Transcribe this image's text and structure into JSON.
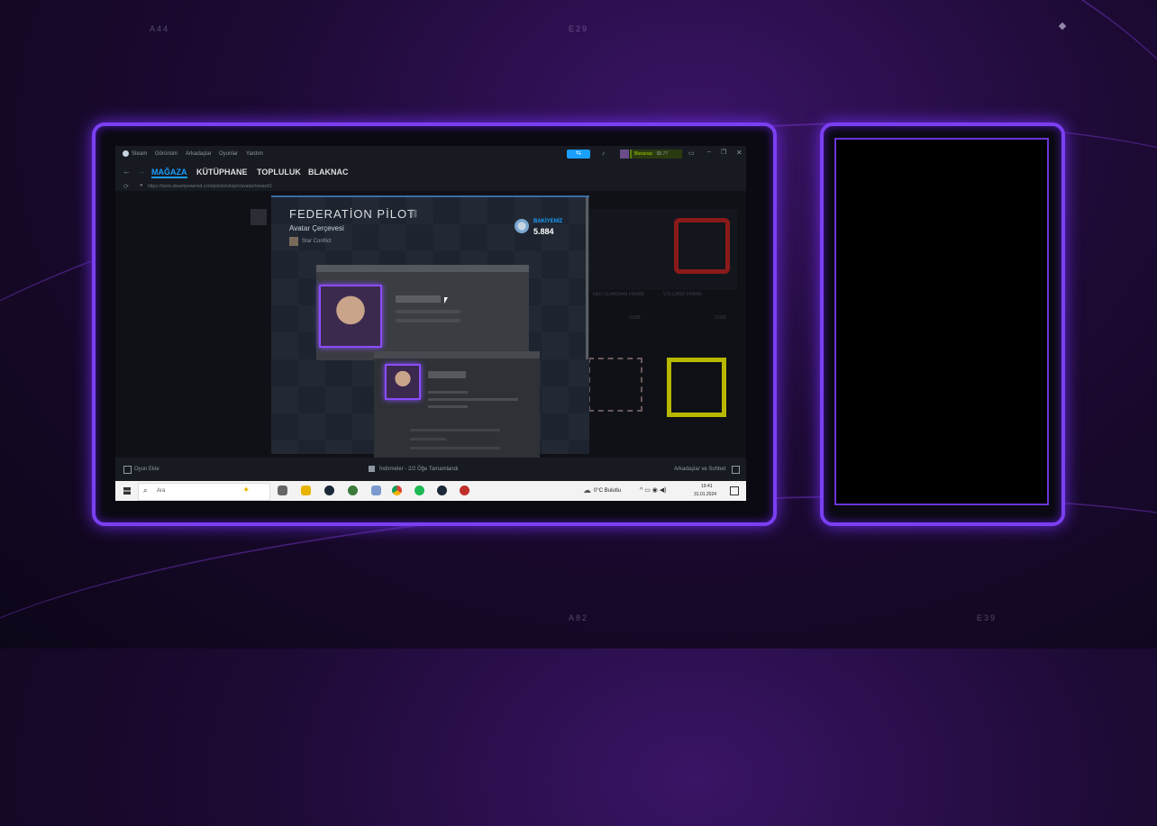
{
  "overlay": {
    "corner_labels": [
      "A44",
      "E29",
      "A82",
      "E39"
    ]
  },
  "steam": {
    "titlebar_menu": [
      "Steam",
      "Görünüm",
      "Arkadaşlar",
      "Oyunlar",
      "Yardım"
    ],
    "user": {
      "name": "Blessnac",
      "balance": "$5.77"
    },
    "nav_tabs": [
      "MAĞAZA",
      "KÜTÜPHANE",
      "TOPLULUK",
      "BLAKNAC"
    ],
    "url": "https://store.steampowered.com/points/shop/c/avatar/reward/1",
    "item": {
      "title": "FEDERATİON PİLOT",
      "subtitle": "Avatar Çerçevesi",
      "game": "Star Conflict",
      "balance_label": "BAKİYENİZ",
      "balance_value": "5.884"
    },
    "background_items": [
      {
        "name": "NED GUARDIAN FRAME",
        "price": "3.000"
      },
      {
        "name": "VOLCANO FRAME",
        "price": "3.000"
      }
    ],
    "footer": {
      "add_game": "Oyun Ekle",
      "downloads": "İndirmeler - 2/2 Öğe Tamamlandı",
      "friends": "Arkadaşlar ve Sohbet"
    }
  },
  "taskbar": {
    "search_placeholder": "Ara",
    "weather": "0°C Bulutlu",
    "time": "19:41",
    "date": "31.01.2024"
  },
  "colors": {
    "frame_glow": "#7b3ff2",
    "steam_dark": "#171a21",
    "steam_accent": "#1a9fff",
    "online_green": "#5c7e10"
  }
}
